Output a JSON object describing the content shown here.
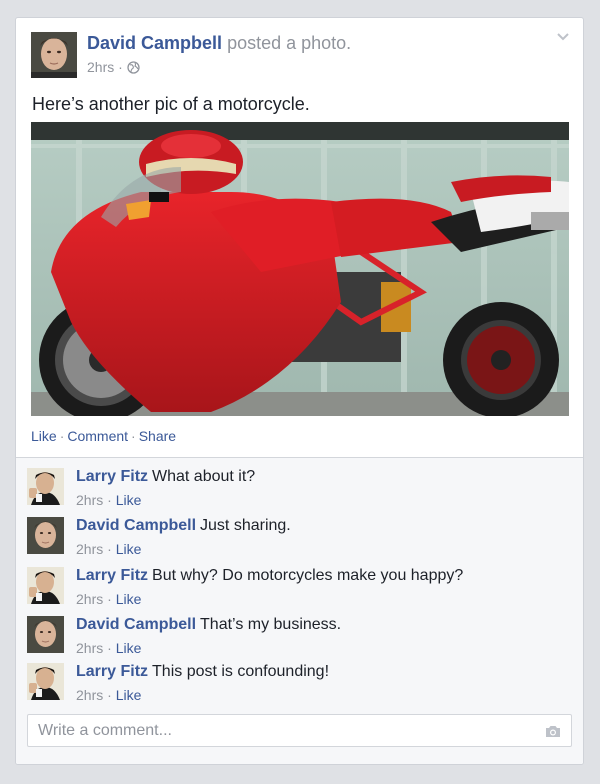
{
  "post": {
    "author": "David Campbell",
    "action": "posted a photo.",
    "time": "2hrs",
    "privacy_icon": "globe-icon",
    "text": "Here’s another pic of a motorcycle.",
    "photo_subject": "red sport motorcycle"
  },
  "actions": {
    "like": "Like",
    "comment": "Comment",
    "share": "Share",
    "separator": "·"
  },
  "comments": [
    {
      "author": "Larry Fitz",
      "text": "What about it?",
      "time": "2hrs",
      "like": "Like"
    },
    {
      "author": "David Campbell",
      "text": "Just sharing.",
      "time": "2hrs",
      "like": "Like"
    },
    {
      "author": "Larry Fitz",
      "text": "But why? Do motorcycles make you happy?",
      "time": "2hrs",
      "like": "Like"
    },
    {
      "author": "David Campbell",
      "text": "That’s my business.",
      "time": "2hrs",
      "like": "Like"
    },
    {
      "author": "Larry Fitz",
      "text": "This post is confounding!",
      "time": "2hrs",
      "like": "Like"
    }
  ],
  "comment_box": {
    "placeholder": "Write a comment...",
    "camera_icon": "camera-icon"
  },
  "colors": {
    "link": "#3b5998",
    "meta": "#90949c",
    "background": "#dfe1e5"
  }
}
